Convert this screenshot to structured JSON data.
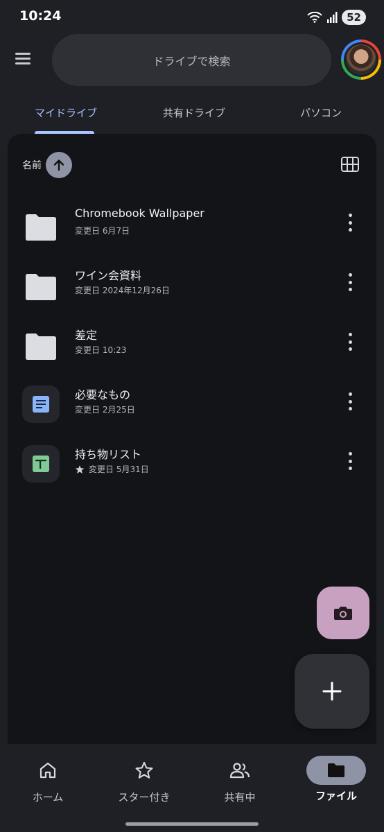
{
  "status_bar": {
    "time": "10:24",
    "battery": "52"
  },
  "header": {
    "search_placeholder": "ドライブで検索"
  },
  "tabs": [
    {
      "label": "マイドライブ",
      "active": true
    },
    {
      "label": "共有ドライブ",
      "active": false
    },
    {
      "label": "パソコン",
      "active": false
    }
  ],
  "sort": {
    "label": "名前"
  },
  "files": [
    {
      "name": "Chromebook Wallpaper",
      "meta": "変更日 6月7日",
      "type": "folder",
      "starred": false
    },
    {
      "name": "ワイン会資料",
      "meta": "変更日 2024年12月26日",
      "type": "folder",
      "starred": false
    },
    {
      "name": "差定",
      "meta": "変更日 10:23",
      "type": "folder",
      "starred": false
    },
    {
      "name": "必要なもの",
      "meta": "変更日 2月25日",
      "type": "doc",
      "starred": false
    },
    {
      "name": "持ち物リスト",
      "meta": "変更日 5月31日",
      "type": "sheet",
      "starred": true
    }
  ],
  "bottom_nav": [
    {
      "label": "ホーム",
      "icon": "home-icon",
      "active": false
    },
    {
      "label": "スター付き",
      "icon": "star-icon",
      "active": false
    },
    {
      "label": "共有中",
      "icon": "people-icon",
      "active": false
    },
    {
      "label": "ファイル",
      "icon": "folder-icon",
      "active": true
    }
  ],
  "colors": {
    "accent": "#a9c3ff",
    "camera_fab": "#c9a1c0",
    "doc": "#8ab4f8",
    "sheet": "#81c995"
  }
}
